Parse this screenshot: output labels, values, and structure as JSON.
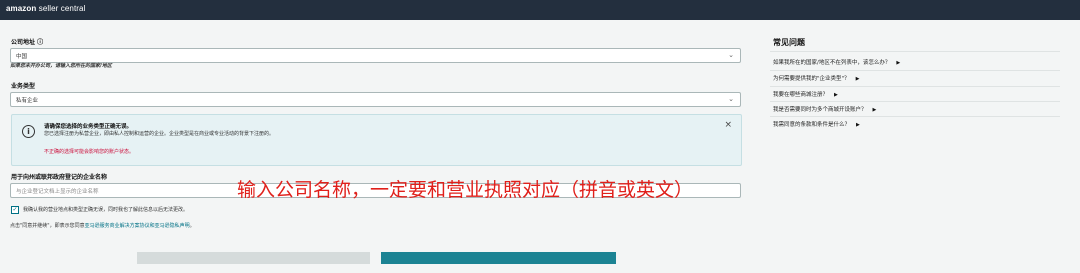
{
  "brand": {
    "logo_a": "amazon",
    "logo_b": " seller central"
  },
  "form": {
    "country_label": "公司地址 ⓘ",
    "country_value": "中国",
    "country_note": "如果您未开办公司，请输入您所在的国家/地区",
    "biz_type_label": "业务类型",
    "biz_type_value": "私有企业",
    "info": {
      "title": "请确保您选择的业务类型正确无误。",
      "body": "您已选择注册为私营企业，即由私人控制和运营的企业。企业类型是在商业或专业活动的背景下注册的。",
      "warning": "不正确的选择可能会影响您的账户状态。"
    },
    "company_name_label": "用于向州或联邦政府登记的企业名称",
    "company_name_placeholder": "与企业登记文档上显示的企业名称",
    "confirm_checkbox": "我确认我的营业地点和类型正确无误，同时我也了解此信息以后无法更改。",
    "terms_prefix": "点击\"同意并继续\"，即表示您同意",
    "terms_link": "亚马逊服务商业解决方案协议和亚马逊隐私声明",
    "terms_suffix": "。"
  },
  "annotation": {
    "text": "输入公司名称，一定要和营业执照对应（拼音或英文）",
    "color": "#e0201b"
  },
  "faq": {
    "title": "常见问题",
    "items": [
      {
        "label": "如果我所在的国家/地区不在列表中，该怎么办？"
      },
      {
        "label": "为何需要提供我的\"企业类型\"？"
      },
      {
        "label": "我要在哪些商城注册？"
      },
      {
        "label": "我是否需要同时为多个商城开设账户？"
      },
      {
        "label": "我需同意的条款和条件是什么？"
      }
    ]
  },
  "colors": {
    "topbar": "#232f3e",
    "primary_button": "#1b8393",
    "info_bg": "#e6f2f4"
  }
}
